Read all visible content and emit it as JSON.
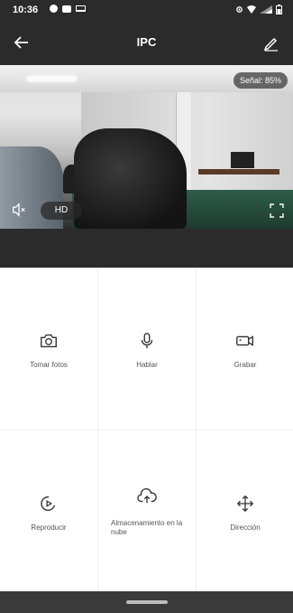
{
  "status_bar": {
    "time": "10:36"
  },
  "app_bar": {
    "title": "IPC"
  },
  "video": {
    "signal_label": "Señal: 85%",
    "quality_label": "HD"
  },
  "actions": [
    {
      "label": "Tomar fotos",
      "icon": "camera-icon"
    },
    {
      "label": "Hablar",
      "icon": "microphone-icon"
    },
    {
      "label": "Grabar",
      "icon": "video-record-icon"
    },
    {
      "label": "Reproducir",
      "icon": "playback-icon"
    },
    {
      "label": "Almacenamiento en la nube",
      "icon": "cloud-upload-icon"
    },
    {
      "label": "Dirección",
      "icon": "direction-arrows-icon"
    }
  ],
  "colors": {
    "header": "#2b2b2b",
    "background": "#ffffff",
    "label": "#555555"
  }
}
